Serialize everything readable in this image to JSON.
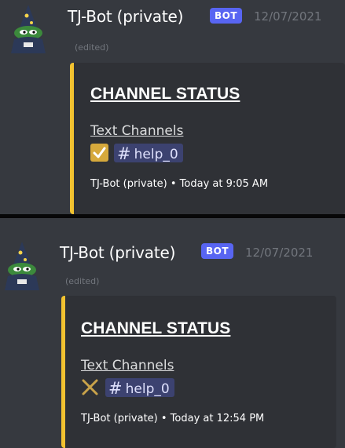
{
  "messages": [
    {
      "author": "TJ-Bot (private)",
      "badge": "BOT",
      "timestamp": "12/07/2021",
      "edited": "(edited)",
      "avatar_icon": "pepe-wizard-avatar",
      "embed": {
        "title": "CHANNEL STATUS",
        "field_name": "Text Channels",
        "status_icon": "check-icon",
        "channel": "help_0",
        "footer": "TJ-Bot (private) • Today at 9:05 AM",
        "accent_color": "#f2c230"
      }
    },
    {
      "author": "TJ-Bot (private)",
      "badge": "BOT",
      "timestamp": "12/07/2021",
      "edited": "(edited)",
      "avatar_icon": "pepe-wizard-avatar",
      "embed": {
        "title": "CHANNEL STATUS",
        "field_name": "Text Channels",
        "status_icon": "cross-icon",
        "channel": "help_0",
        "footer": "TJ-Bot (private) • Today at 12:54 PM",
        "accent_color": "#f2c230"
      }
    }
  ],
  "colors": {
    "background": "#36393f",
    "embed_background": "#2f3136",
    "badge": "#5865f2",
    "mention_background": "#3c4270",
    "check": "#d6a93c"
  }
}
